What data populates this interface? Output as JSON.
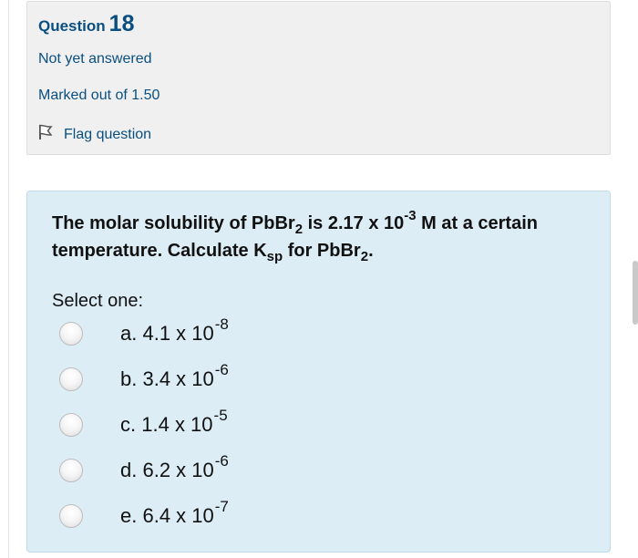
{
  "question": {
    "label": "Question",
    "number": "18",
    "status": "Not yet answered",
    "marks": "Marked out of 1.50",
    "flag_label": "Flag question"
  },
  "content": {
    "text_part1": "The molar solubility of PbBr",
    "text_sub1": "2",
    "text_part2": " is 2.17 x 10",
    "text_sup1": "-3",
    "text_part3": " M at a certain temperature. Calculate K",
    "text_sub2": "sp",
    "text_part4": " for PbBr",
    "text_sub3": "2",
    "text_part5": ".",
    "prompt": "Select one:"
  },
  "options": [
    {
      "letter": "a.",
      "base": "4.1 x 10",
      "exp": "-8",
      "selected": false
    },
    {
      "letter": "b.",
      "base": "3.4 x 10",
      "exp": "-6",
      "selected": false
    },
    {
      "letter": "c.",
      "base": "1.4 x 10",
      "exp": "-5",
      "selected": false
    },
    {
      "letter": "d.",
      "base": "6.2 x 10",
      "exp": "-6",
      "selected": false
    },
    {
      "letter": "e.",
      "base": "6.4 x 10",
      "exp": "-7",
      "selected": false
    }
  ],
  "colors": {
    "heading": "#0a4f80",
    "info_bg": "#f0f0f0",
    "content_bg": "#dcedf6",
    "flag": "#555555"
  },
  "icons": {
    "flag": "flag-icon",
    "radio": "radio-button"
  }
}
